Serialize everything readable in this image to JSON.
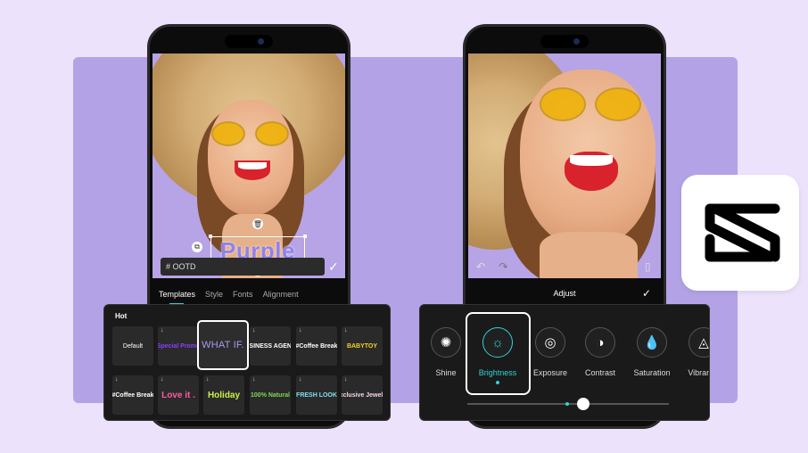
{
  "left_phone": {
    "overlay_text": "Purple",
    "caption_input": "# OOTD",
    "tabs": [
      {
        "label": "Templates"
      },
      {
        "label": "Style"
      },
      {
        "label": "Fonts"
      },
      {
        "label": "Alignment"
      }
    ],
    "active_tab": "Templates"
  },
  "template_panel": {
    "section_title": "Hot",
    "templates": [
      {
        "label": "Default",
        "color": "#ffffff"
      },
      {
        "label": "Special Promo",
        "color": "#8b3dff"
      },
      {
        "label": "WHAT IF.",
        "color": "#a89af2",
        "selected": true
      },
      {
        "label": "BUSINESS AGENCY",
        "color": "#ffffff"
      },
      {
        "label": "#Coffee Break",
        "color": "#ffffff"
      },
      {
        "label": "BABYTOY",
        "color": "#f2d22a"
      },
      {
        "label": "#Coffee Break",
        "color": "#ffffff"
      },
      {
        "label": "Love it .",
        "color": "#ff5aa5"
      },
      {
        "label": "Holiday",
        "color": "#c9f04a"
      },
      {
        "label": "100% Natural",
        "color": "#7ed957"
      },
      {
        "label": "FRESH LOOK",
        "color": "#7de0ef"
      },
      {
        "label": "Exclusive Jewelry",
        "color": "#f0d6e8"
      }
    ]
  },
  "right_phone": {
    "panel_title": "Adjust"
  },
  "adjust_panel": {
    "items": [
      {
        "label": "Shine",
        "icon": "sun-sparkle-icon"
      },
      {
        "label": "Brightness",
        "icon": "sun-icon",
        "selected": true
      },
      {
        "label": "Exposure",
        "icon": "exposure-icon"
      },
      {
        "label": "Contrast",
        "icon": "contrast-icon"
      },
      {
        "label": "Saturation",
        "icon": "droplet-icon"
      },
      {
        "label": "Vibrance",
        "icon": "vibrance-icon"
      }
    ]
  },
  "logo": {
    "name": "capcut-logo-icon"
  },
  "colors": {
    "accent": "#2fd2d8",
    "background": "#ece2fb",
    "panel": "#b3a3e6"
  }
}
